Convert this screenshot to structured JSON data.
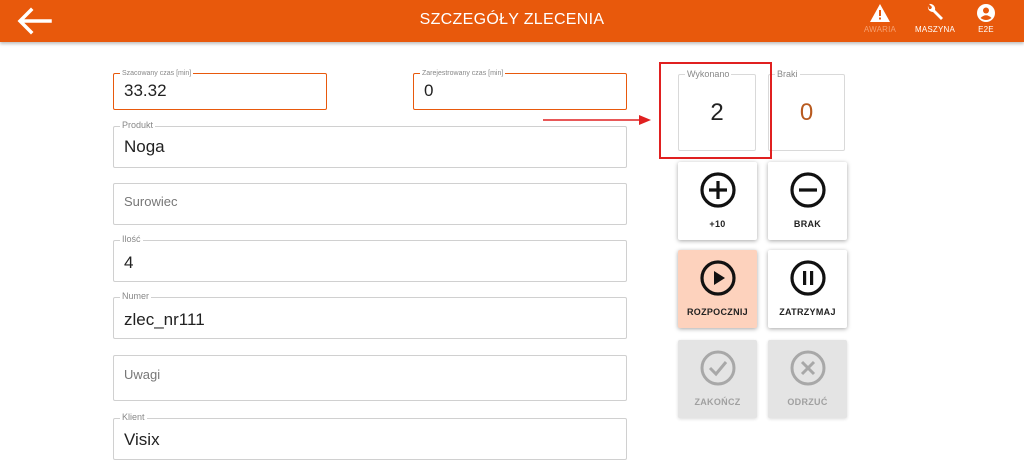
{
  "header": {
    "title": "SZCZEGÓŁY ZLECENIA",
    "back_icon": "arrow-left-icon",
    "actions": [
      {
        "label": "AWARIA",
        "icon": "warning-icon",
        "state": "dimmed"
      },
      {
        "label": "MASZYNA",
        "icon": "wrench-icon",
        "state": "normal"
      },
      {
        "label": "E2E",
        "icon": "user-icon",
        "state": "normal"
      }
    ]
  },
  "form": {
    "estimated_time": {
      "label": "Szacowany czas [min]",
      "value": "33.32"
    },
    "registered_time": {
      "label": "Zarejestrowany czas [min]",
      "value": "0"
    },
    "product": {
      "label": "Produkt",
      "value": "Noga"
    },
    "raw_material": {
      "placeholder": "Surowiec"
    },
    "quantity": {
      "label": "Ilość",
      "value": "4"
    },
    "number": {
      "label": "Numer",
      "value": "zlec_nr111"
    },
    "notes": {
      "placeholder": "Uwagi"
    },
    "client": {
      "label": "Klient",
      "value": "Visix"
    }
  },
  "counters": {
    "done": {
      "label": "Wykonano",
      "value": "2"
    },
    "defects": {
      "label": "Braki",
      "value": "0",
      "color": "#b85a1f"
    }
  },
  "actions": {
    "plus10": {
      "label": "+10",
      "icon": "plus-circle-icon"
    },
    "defect": {
      "label": "BRAK",
      "icon": "minus-circle-icon"
    },
    "start": {
      "label": "ROZPOCZNIJ",
      "icon": "play-circle-icon",
      "color": "#fdd2bd"
    },
    "pause": {
      "label": "ZATRZYMAJ",
      "icon": "pause-circle-icon"
    },
    "finish": {
      "label": "ZAKOŃCZ",
      "icon": "check-circle-icon",
      "state": "disabled"
    },
    "reject": {
      "label": "ODRZUĆ",
      "icon": "x-circle-icon",
      "state": "disabled"
    }
  },
  "colors": {
    "brand": "#e8590c",
    "highlight": "#e02020"
  }
}
